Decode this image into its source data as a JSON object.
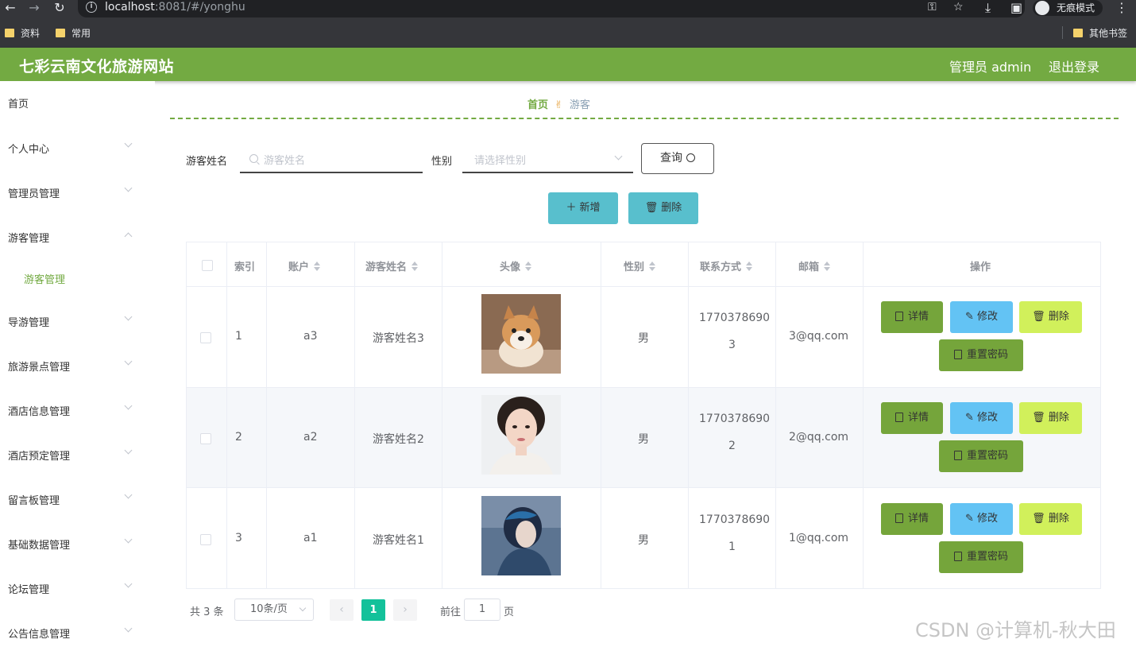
{
  "browser": {
    "url_host": "localhost",
    "url_path": ":8081/#/yonghu",
    "incognito_label": "无痕模式",
    "bookmarks": [
      "资料",
      "常用"
    ],
    "other_bookmarks": "其他书签"
  },
  "header": {
    "title": "七彩云南文化旅游网站",
    "user": "管理员 admin",
    "logout": "退出登录",
    "color": "#73aa42"
  },
  "sidebar": {
    "items": [
      {
        "label": "首页"
      },
      {
        "label": "个人中心"
      },
      {
        "label": "管理员管理"
      },
      {
        "label": "游客管理"
      },
      {
        "label": "游客管理"
      },
      {
        "label": "导游管理"
      },
      {
        "label": "旅游景点管理"
      },
      {
        "label": "酒店信息管理"
      },
      {
        "label": "酒店预定管理"
      },
      {
        "label": "留言板管理"
      },
      {
        "label": "基础数据管理"
      },
      {
        "label": "论坛管理"
      },
      {
        "label": "公告信息管理"
      }
    ]
  },
  "breadcrumb": {
    "home": "首页",
    "current": "游客"
  },
  "search": {
    "name_label": "游客姓名",
    "name_placeholder": "游客姓名",
    "gender_label": "性别",
    "gender_placeholder": "请选择性别",
    "query_button": "查询"
  },
  "actions": {
    "add": "新增",
    "delete": "删除"
  },
  "table": {
    "columns": [
      "索引",
      "账户",
      "游客姓名",
      "头像",
      "性别",
      "联系方式",
      "邮箱",
      "操作"
    ],
    "rows": [
      {
        "index": "1",
        "account": "a3",
        "name": "游客姓名3",
        "gender": "男",
        "phone_a": "1770378690",
        "phone_b": "3",
        "email": "3@qq.com"
      },
      {
        "index": "2",
        "account": "a2",
        "name": "游客姓名2",
        "gender": "男",
        "phone_a": "1770378690",
        "phone_b": "2",
        "email": "2@qq.com"
      },
      {
        "index": "3",
        "account": "a1",
        "name": "游客姓名1",
        "gender": "男",
        "phone_a": "1770378690",
        "phone_b": "1",
        "email": "1@qq.com"
      }
    ],
    "op": {
      "detail": "详情",
      "edit": "修改",
      "delete": "删除",
      "reset": "重置密码"
    }
  },
  "pagination": {
    "total": "共 3 条",
    "page_size": "10条/页",
    "current": "1",
    "goto": "前往",
    "goto_value": "1",
    "page": "页"
  },
  "watermark": "CSDN @计算机-秋大田"
}
